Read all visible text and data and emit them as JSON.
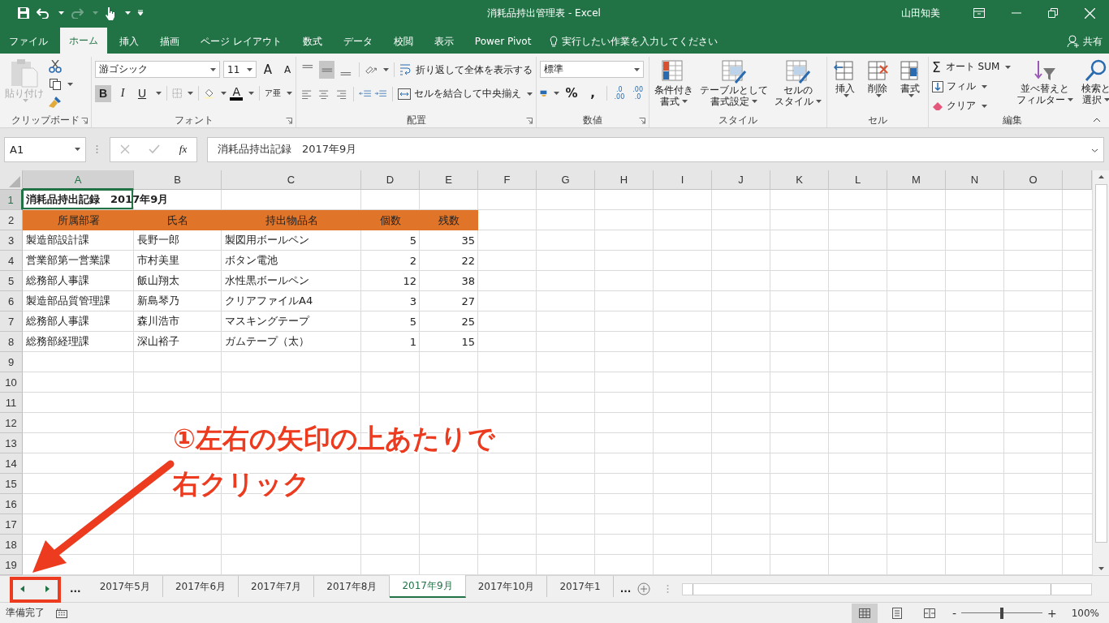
{
  "title_bar": {
    "title": "消耗品持出管理表  -  Excel",
    "user": "山田知美"
  },
  "ribbon_tabs": [
    {
      "label": "ファイル",
      "selected": false
    },
    {
      "label": "ホーム",
      "selected": true
    },
    {
      "label": "挿入",
      "selected": false
    },
    {
      "label": "描画",
      "selected": false
    },
    {
      "label": "ページ レイアウト",
      "selected": false
    },
    {
      "label": "数式",
      "selected": false
    },
    {
      "label": "データ",
      "selected": false
    },
    {
      "label": "校閲",
      "selected": false
    },
    {
      "label": "表示",
      "selected": false
    },
    {
      "label": "Power Pivot",
      "selected": false
    }
  ],
  "tell_me": "実行したい作業を入力してください",
  "share": "共有",
  "ribbon": {
    "clipboard": {
      "label": "クリップボード",
      "paste": "貼り付け",
      "paste_disabled": true
    },
    "font": {
      "label": "フォント",
      "font_name": "游ゴシック",
      "font_size": "11",
      "grow": "A",
      "shrink": "A",
      "font_color": "A",
      "phonetic": "ア亜",
      "style_buttons": [
        {
          "label": "B",
          "on": true
        },
        {
          "label": "I",
          "on": false
        },
        {
          "label": "U",
          "on": false
        }
      ]
    },
    "alignment": {
      "label": "配置",
      "wrap_text": "折り返して全体を表示する",
      "merge": "セルを結合して中央揃え",
      "vertical": [
        {
          "selected": false
        },
        {
          "selected": true
        },
        {
          "selected": false
        }
      ]
    },
    "number": {
      "label": "数値",
      "format": "標準",
      "percent": "%",
      "comma": ",",
      "decimals": [
        {
          "top": ".0",
          "bottom": ".00"
        },
        {
          "top": ".00",
          "bottom": ".0"
        }
      ]
    },
    "styles": {
      "label": "スタイル",
      "buttons": [
        {
          "lines": [
            "条件付き",
            "書式"
          ]
        },
        {
          "lines": [
            "テーブルとして",
            "書式設定"
          ]
        },
        {
          "lines": [
            "セルの",
            "スタイル"
          ]
        }
      ]
    },
    "cells": {
      "label": "セル",
      "buttons": [
        "挿入",
        "削除",
        "書式"
      ]
    },
    "editing": {
      "label": "編集",
      "sigma": "Σ",
      "autosum": "オート SUM",
      "fill": "フィル",
      "clear": "クリア",
      "sort_lines": [
        "並べ替えと",
        "フィルター"
      ],
      "find_lines": [
        "検索と",
        "選択"
      ]
    }
  },
  "formula_bar": {
    "name_box": "A1",
    "fx": "fx",
    "formula": "消耗品持出記録　2017年9月"
  },
  "sheet": {
    "columns": [
      {
        "letter": "A",
        "selected": true
      },
      {
        "letter": "B",
        "selected": false
      },
      {
        "letter": "C",
        "selected": false
      },
      {
        "letter": "D",
        "selected": false
      },
      {
        "letter": "E",
        "selected": false
      },
      {
        "letter": "F",
        "selected": false
      },
      {
        "letter": "G",
        "selected": false
      },
      {
        "letter": "H",
        "selected": false
      },
      {
        "letter": "I",
        "selected": false
      },
      {
        "letter": "J",
        "selected": false
      },
      {
        "letter": "K",
        "selected": false
      },
      {
        "letter": "L",
        "selected": false
      },
      {
        "letter": "M",
        "selected": false
      },
      {
        "letter": "N",
        "selected": false
      },
      {
        "letter": "O",
        "selected": false
      }
    ],
    "rows": [
      {
        "number": "1",
        "selected": true,
        "kind": "title",
        "cells": [
          "消耗品持出記録　2017年9月"
        ]
      },
      {
        "number": "2",
        "selected": false,
        "kind": "header",
        "cells": [
          "所属部署",
          "氏名",
          "持出物品名",
          "個数",
          "残数"
        ]
      },
      {
        "number": "3",
        "selected": false,
        "kind": "data",
        "cells": [
          "製造部設計課",
          "長野一郎",
          "製図用ボールペン",
          "5",
          "35"
        ]
      },
      {
        "number": "4",
        "selected": false,
        "kind": "data",
        "cells": [
          "営業部第一営業課",
          "市村美里",
          "ボタン電池",
          "2",
          "22"
        ]
      },
      {
        "number": "5",
        "selected": false,
        "kind": "data",
        "cells": [
          "総務部人事課",
          "飯山翔太",
          "水性黒ボールペン",
          "12",
          "38"
        ]
      },
      {
        "number": "6",
        "selected": false,
        "kind": "data",
        "cells": [
          "製造部品質管理課",
          "新島琴乃",
          "クリアファイルA4",
          "3",
          "27"
        ]
      },
      {
        "number": "7",
        "selected": false,
        "kind": "data",
        "cells": [
          "総務部人事課",
          "森川浩市",
          "マスキングテープ",
          "5",
          "25"
        ]
      },
      {
        "number": "8",
        "selected": false,
        "kind": "data",
        "cells": [
          "総務部経理課",
          "深山裕子",
          "ガムテープ（太）",
          "1",
          "15"
        ]
      },
      {
        "number": "9",
        "selected": false,
        "kind": "empty"
      },
      {
        "number": "10",
        "selected": false,
        "kind": "empty"
      },
      {
        "number": "11",
        "selected": false,
        "kind": "empty"
      },
      {
        "number": "12",
        "selected": false,
        "kind": "empty"
      },
      {
        "number": "13",
        "selected": false,
        "kind": "empty"
      },
      {
        "number": "14",
        "selected": false,
        "kind": "empty"
      },
      {
        "number": "15",
        "selected": false,
        "kind": "empty"
      },
      {
        "number": "16",
        "selected": false,
        "kind": "empty"
      },
      {
        "number": "17",
        "selected": false,
        "kind": "empty"
      },
      {
        "number": "18",
        "selected": false,
        "kind": "empty"
      },
      {
        "number": "19",
        "selected": false,
        "kind": "empty"
      }
    ]
  },
  "sheet_tabs": {
    "more_left": "...",
    "tabs": [
      {
        "label": "2017年5月",
        "selected": false
      },
      {
        "label": "2017年6月",
        "selected": false
      },
      {
        "label": "2017年7月",
        "selected": false
      },
      {
        "label": "2017年8月",
        "selected": false
      },
      {
        "label": "2017年9月",
        "selected": true
      },
      {
        "label": "2017年10月",
        "selected": false
      },
      {
        "label": "2017年1",
        "selected": false
      }
    ],
    "more_right": "..."
  },
  "status_bar": {
    "status": "準備完了",
    "views": [
      {
        "kind": "normal",
        "selected": true
      },
      {
        "kind": "page_layout",
        "selected": false
      },
      {
        "kind": "page_break",
        "selected": false
      }
    ],
    "zoom_out": "-",
    "zoom_in": "+",
    "level": 0.5,
    "zoom": "100%"
  },
  "annotation": {
    "lines": [
      "①左右の矢印の上あたりで",
      "右クリック"
    ]
  }
}
